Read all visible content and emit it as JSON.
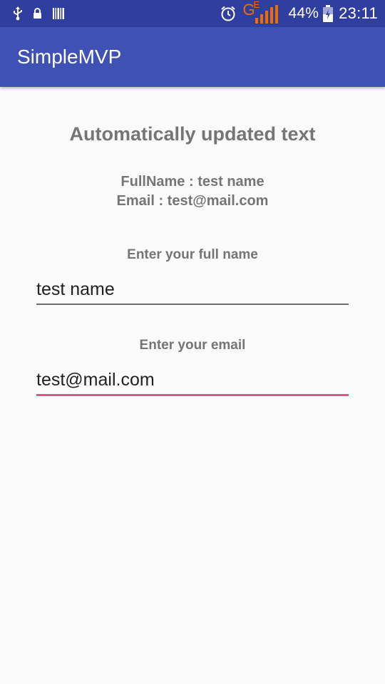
{
  "status_bar": {
    "battery_percent": "44%",
    "time": "23:11",
    "network_type": "G",
    "network_sub": "E",
    "icons": [
      "usb-icon",
      "lock-icon",
      "barcode-icon",
      "alarm-icon",
      "signal-icon",
      "battery-icon"
    ],
    "network_color": "#ef6c00"
  },
  "app_bar": {
    "title": "SimpleMVP",
    "color": "#3f51b5"
  },
  "main": {
    "heading": "Automatically updated text",
    "full_name_line": "FullName : test name",
    "email_line": "Email : test@mail.com",
    "name_label": "Enter your full name",
    "name_value": "test name",
    "email_label": "Enter your email",
    "email_value": "test@mail.com",
    "accent_color": "#e84f85"
  }
}
